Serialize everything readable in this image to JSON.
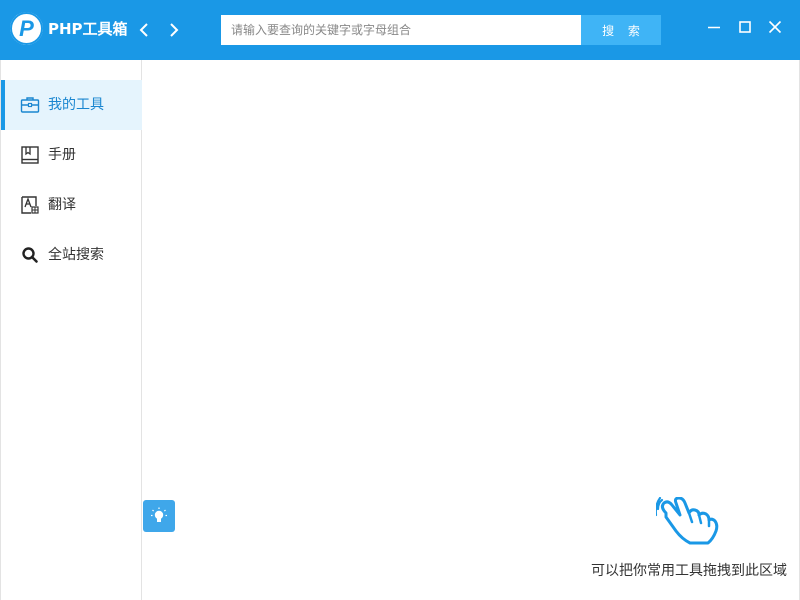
{
  "app": {
    "title": "PHP工具箱",
    "accent_color": "#1a98e6",
    "logo_icon": "php-logo"
  },
  "nav": {
    "back_icon": "chevron-left-icon",
    "forward_icon": "chevron-right-icon"
  },
  "search": {
    "placeholder": "请输入要查询的关键字或字母组合",
    "value": "",
    "button_label": "搜 索"
  },
  "window_controls": {
    "minimize_icon": "minimize-icon",
    "maximize_icon": "maximize-icon",
    "close_icon": "close-icon"
  },
  "sidebar": {
    "items": [
      {
        "label": "我的工具",
        "icon": "toolbox-icon",
        "active": true
      },
      {
        "label": "手册",
        "icon": "book-icon",
        "active": false
      },
      {
        "label": "翻译",
        "icon": "translate-icon",
        "active": false
      },
      {
        "label": "全站搜索",
        "icon": "search-icon",
        "active": false
      }
    ]
  },
  "main": {
    "tip_icon": "lightbulb-icon",
    "drop_icon": "hand-pointer-icon",
    "drop_hint": "可以把你常用工具拖拽到此区域"
  }
}
